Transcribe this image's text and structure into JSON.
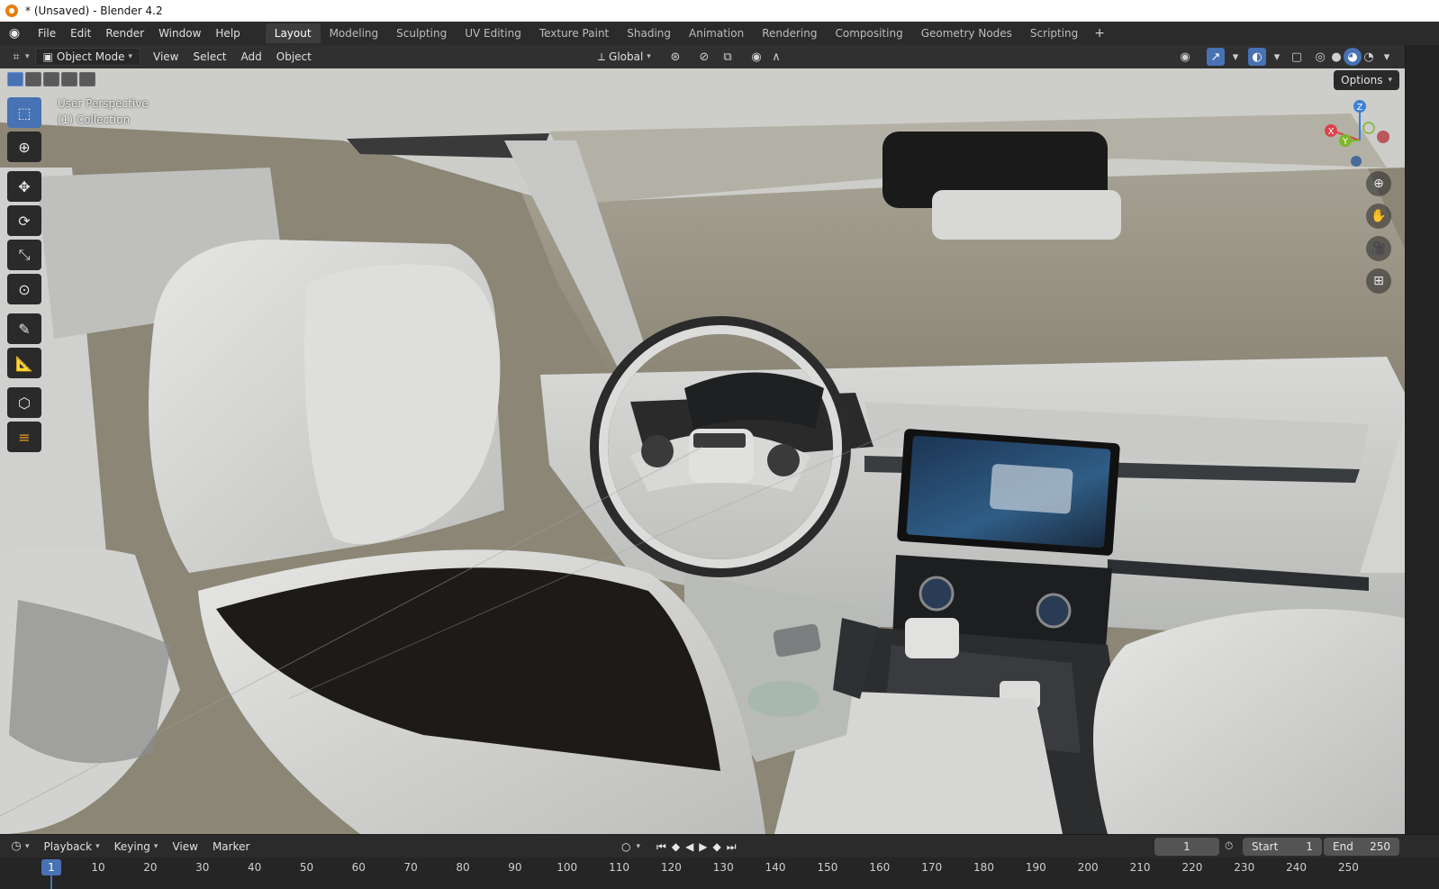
{
  "window": {
    "title": "* (Unsaved) - Blender 4.2"
  },
  "menu": {
    "items": [
      "File",
      "Edit",
      "Render",
      "Window",
      "Help"
    ]
  },
  "workspaces": [
    "Layout",
    "Modeling",
    "Sculpting",
    "UV Editing",
    "Texture Paint",
    "Shading",
    "Animation",
    "Rendering",
    "Compositing",
    "Geometry Nodes",
    "Scripting"
  ],
  "workspace_plus": "+",
  "header": {
    "mode": "Object Mode",
    "menus": [
      "View",
      "Select",
      "Add",
      "Object"
    ],
    "transform_orientation": "Global"
  },
  "viewport": {
    "perspective": "User Perspective",
    "collection": "(1) Collection",
    "options": "Options",
    "gizmo": {
      "x": "X",
      "y": "Y",
      "z": "Z",
      "x_color": "#d9434a",
      "y_color": "#7fb72b",
      "z_color": "#3d7fd6"
    }
  },
  "timeline": {
    "playback": "Playback",
    "keying": "Keying",
    "view": "View",
    "marker": "Marker",
    "current_frame": "1",
    "start_label": "Start",
    "start": "1",
    "end_label": "End",
    "end": "250",
    "ruler_current": "1",
    "ticks": [
      "10",
      "20",
      "30",
      "40",
      "50",
      "60",
      "70",
      "80",
      "90",
      "100",
      "110",
      "120",
      "130",
      "140",
      "150",
      "160",
      "170",
      "180",
      "190",
      "200",
      "210",
      "220",
      "230",
      "240",
      "250"
    ]
  },
  "colors": {
    "accent": "#4772b3",
    "blender_orange": "#e87d0d"
  }
}
